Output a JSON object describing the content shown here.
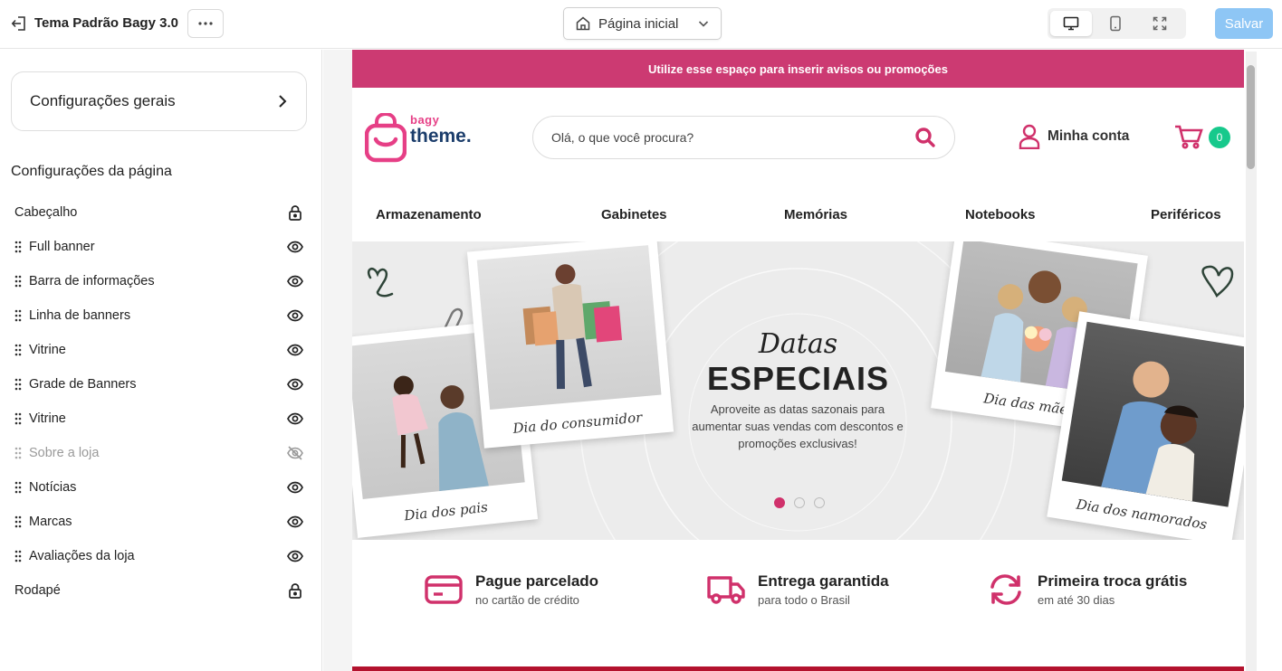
{
  "topbar": {
    "theme_name": "Tema Padrão Bagy 3.0",
    "page_select": "Página inicial",
    "save_label": "Salvar"
  },
  "sidebar": {
    "general_settings": "Configurações gerais",
    "page_settings_title": "Configurações da página",
    "items": [
      {
        "label": "Cabeçalho",
        "draggable": false,
        "state": "locked"
      },
      {
        "label": "Full banner",
        "draggable": true,
        "state": "visible"
      },
      {
        "label": "Barra de informações",
        "draggable": true,
        "state": "visible"
      },
      {
        "label": "Linha de banners",
        "draggable": true,
        "state": "visible"
      },
      {
        "label": "Vitrine",
        "draggable": true,
        "state": "visible"
      },
      {
        "label": "Grade de Banners",
        "draggable": true,
        "state": "visible"
      },
      {
        "label": "Vitrine",
        "draggable": true,
        "state": "visible"
      },
      {
        "label": "Sobre a loja",
        "draggable": true,
        "state": "hidden"
      },
      {
        "label": "Notícias",
        "draggable": true,
        "state": "visible"
      },
      {
        "label": "Marcas",
        "draggable": true,
        "state": "visible"
      },
      {
        "label": "Avaliações da loja",
        "draggable": true,
        "state": "visible"
      },
      {
        "label": "Rodapé",
        "draggable": false,
        "state": "locked"
      }
    ]
  },
  "preview": {
    "promo_text": "Utilize esse espaço para inserir avisos ou promoções",
    "logo_line1": "bagy",
    "logo_line2": "theme.",
    "search_placeholder": "Olá, o que você procura?",
    "account_label": "Minha conta",
    "cart_count": "0",
    "nav": [
      "Armazenamento",
      "Gabinetes",
      "Memórias",
      "Notebooks",
      "Periféricos"
    ],
    "banner": {
      "title_script": "Datas",
      "title_bold": "ESPECIAIS",
      "description": "Aproveite as datas sazonais para aumentar suas vendas com descontos e promoções exclusivas!",
      "captions": {
        "pais": "Dia dos pais",
        "consumidor": "Dia do consumidor",
        "maes": "Dia das mães",
        "namorados": "Dia dos namorados"
      },
      "slides": 3,
      "active_slide": 1
    },
    "benefits": [
      {
        "title": "Pague parcelado",
        "subtitle": "no cartão de crédito",
        "icon": "credit-card-icon"
      },
      {
        "title": "Entrega garantida",
        "subtitle": "para todo o Brasil",
        "icon": "truck-icon"
      },
      {
        "title": "Primeira troca grátis",
        "subtitle": "em até 30 dias",
        "icon": "refresh-icon"
      }
    ]
  },
  "colors": {
    "brand_pink": "#cc3a72",
    "accent_pink": "#e63f86",
    "save_button": "#8ec6f5",
    "cart_badge": "#17c98c",
    "logo_navy": "#1b3d6b"
  }
}
